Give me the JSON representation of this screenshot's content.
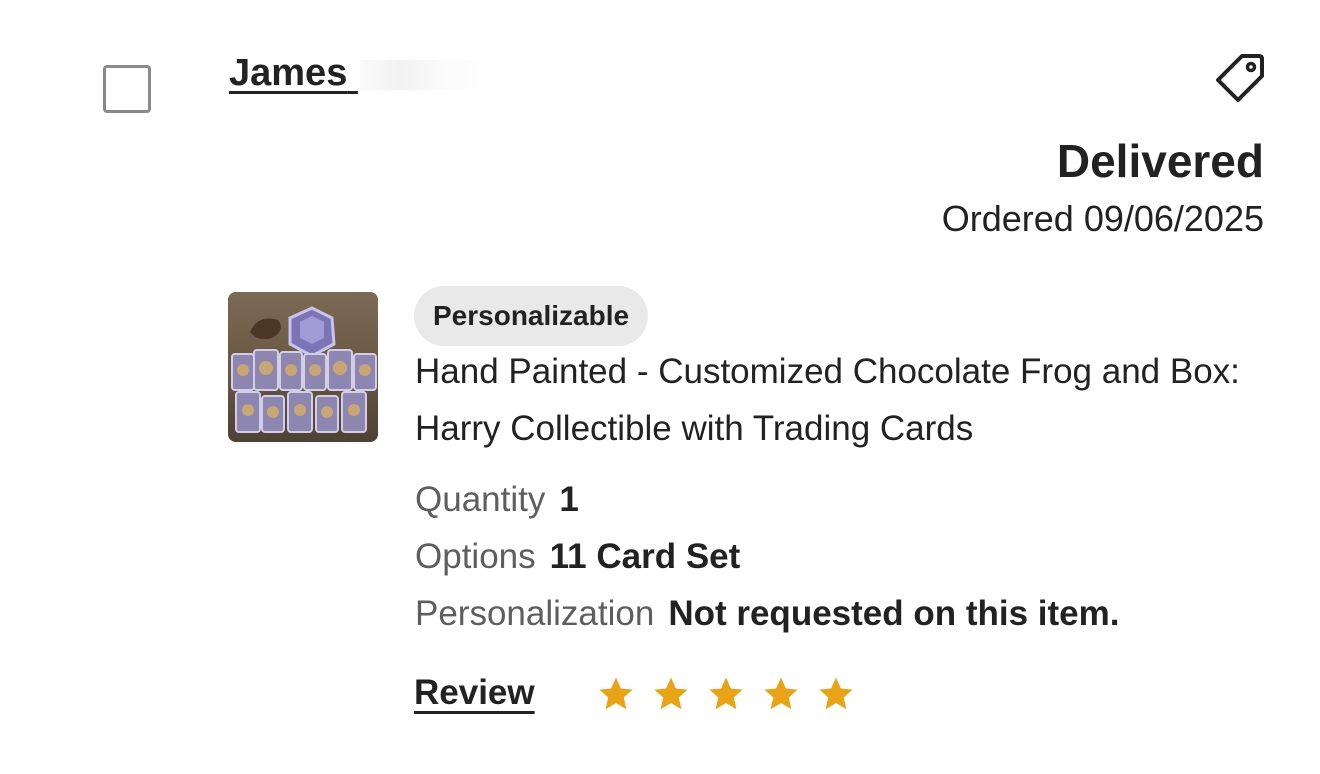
{
  "order": {
    "buyer_name": "James",
    "status": "Delivered",
    "ordered_label": "Ordered 09/06/2025"
  },
  "item": {
    "badge": "Personalizable",
    "title": "Hand Painted - Customized Chocolate Frog and Box: Harry Collectible with Trading Cards",
    "thumbnail": "product-photo",
    "details": [
      {
        "label": "Quantity",
        "value": "1"
      },
      {
        "label": "Options",
        "value": "11 Card Set"
      },
      {
        "label": "Personalization",
        "value": "Not requested on this item."
      }
    ]
  },
  "review": {
    "label": "Review",
    "rating": 5,
    "max_rating": 5,
    "star_color": "#E8A317"
  },
  "icons": {
    "checkbox": "checkbox-unchecked",
    "tag": "tag-icon",
    "star": "star-icon"
  }
}
